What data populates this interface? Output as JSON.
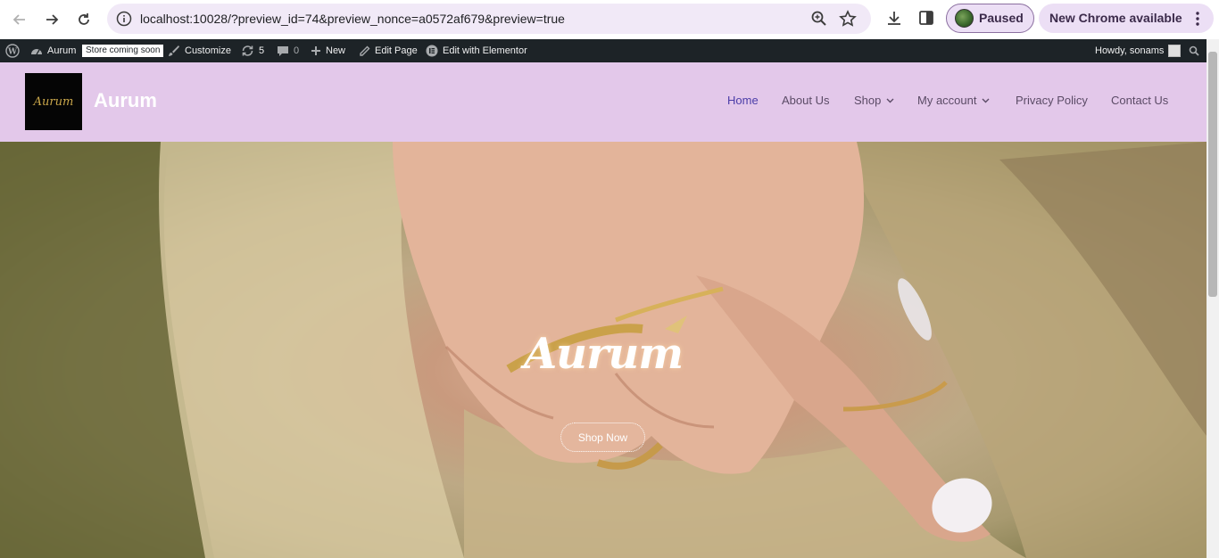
{
  "browser": {
    "url": "localhost:10028/?preview_id=74&preview_nonce=a0572af679&preview=true",
    "profile_status": "Paused",
    "update_label": "New Chrome available"
  },
  "admin_bar": {
    "site_name": "Aurum",
    "store_badge": "Store coming soon",
    "customize": "Customize",
    "updates_count": "5",
    "comments_count": "0",
    "new_label": "New",
    "edit_page": "Edit Page",
    "edit_elementor": "Edit with Elementor",
    "howdy": "Howdy, sonams"
  },
  "site": {
    "logo_text": "Aurum",
    "title": "Aurum",
    "menu": [
      {
        "label": "Home",
        "active": true
      },
      {
        "label": "About Us"
      },
      {
        "label": "Shop",
        "has_dropdown": true
      },
      {
        "label": "My account",
        "has_dropdown": true
      },
      {
        "label": "Privacy Policy"
      },
      {
        "label": "Contact Us"
      }
    ]
  },
  "hero": {
    "title": "Aurum",
    "button": "Shop Now"
  },
  "colors": {
    "header_bg": "#e3c8ea",
    "admin_bar_bg": "#1d2327",
    "active_menu": "#4b3da8"
  }
}
